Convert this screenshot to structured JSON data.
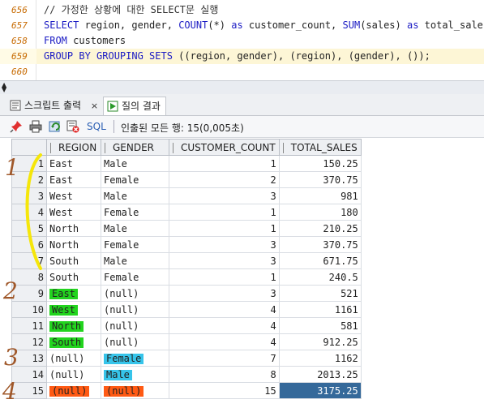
{
  "editor": {
    "lines": [
      {
        "num": "656",
        "tokens": [
          {
            "t": "// 가정한 상황에 대한 SELECT문 실행",
            "c": "cm"
          }
        ]
      },
      {
        "num": "657",
        "tokens": [
          {
            "t": "SELECT",
            "c": "kw"
          },
          {
            "t": " region, gender, ",
            "c": "pl"
          },
          {
            "t": "COUNT",
            "c": "fn"
          },
          {
            "t": "(*) ",
            "c": "pl"
          },
          {
            "t": "as",
            "c": "kw"
          },
          {
            "t": " customer_count, ",
            "c": "pl"
          },
          {
            "t": "SUM",
            "c": "fn"
          },
          {
            "t": "(sales) ",
            "c": "pl"
          },
          {
            "t": "as",
            "c": "kw"
          },
          {
            "t": " total_sales",
            "c": "pl"
          }
        ]
      },
      {
        "num": "658",
        "tokens": [
          {
            "t": "FROM",
            "c": "kw"
          },
          {
            "t": " customers",
            "c": "pl"
          }
        ]
      },
      {
        "num": "659",
        "tokens": [
          {
            "t": "GROUP BY GROUPING SETS",
            "c": "kw"
          },
          {
            "t": " ((region, gender), (region), (gender), ());",
            "c": "pl"
          }
        ]
      },
      {
        "num": "660",
        "tokens": []
      }
    ]
  },
  "tabs": {
    "script_output": "스크립트 출력",
    "close": "×",
    "query_result": "질의 결과"
  },
  "toolbar": {
    "sql": "SQL",
    "status": "인출된 모든 행: 15(0,005초)"
  },
  "grid": {
    "columns": [
      "REGION",
      "GENDER",
      "CUSTOMER_COUNT",
      "TOTAL_SALES"
    ],
    "rows": [
      {
        "n": "1",
        "region": "East",
        "gender": "Male",
        "count": "1",
        "sales": "150.25"
      },
      {
        "n": "2",
        "region": "East",
        "gender": "Female",
        "count": "2",
        "sales": "370.75"
      },
      {
        "n": "3",
        "region": "West",
        "gender": "Male",
        "count": "3",
        "sales": "981"
      },
      {
        "n": "4",
        "region": "West",
        "gender": "Female",
        "count": "1",
        "sales": "180"
      },
      {
        "n": "5",
        "region": "North",
        "gender": "Male",
        "count": "1",
        "sales": "210.25"
      },
      {
        "n": "6",
        "region": "North",
        "gender": "Female",
        "count": "3",
        "sales": "370.75"
      },
      {
        "n": "7",
        "region": "South",
        "gender": "Male",
        "count": "3",
        "sales": "671.75"
      },
      {
        "n": "8",
        "region": "South",
        "gender": "Female",
        "count": "1",
        "sales": "240.5"
      },
      {
        "n": "9",
        "region": "East",
        "gender": "(null)",
        "count": "3",
        "sales": "521",
        "hl_region": "green"
      },
      {
        "n": "10",
        "region": "West",
        "gender": "(null)",
        "count": "4",
        "sales": "1161",
        "hl_region": "green"
      },
      {
        "n": "11",
        "region": "North",
        "gender": "(null)",
        "count": "4",
        "sales": "581",
        "hl_region": "green"
      },
      {
        "n": "12",
        "region": "South",
        "gender": "(null)",
        "count": "4",
        "sales": "912.25",
        "hl_region": "green"
      },
      {
        "n": "13",
        "region": "(null)",
        "gender": "Female",
        "count": "7",
        "sales": "1162",
        "hl_gender": "blue"
      },
      {
        "n": "14",
        "region": "(null)",
        "gender": "Male",
        "count": "8",
        "sales": "2013.25",
        "hl_gender": "blue"
      },
      {
        "n": "15",
        "region": "(null)",
        "gender": "(null)",
        "count": "15",
        "sales": "3175.25",
        "hl_region": "orange",
        "hl_gender": "orange",
        "hl_total": true
      }
    ]
  },
  "annotations": [
    "1",
    "2",
    "3",
    "4"
  ],
  "colors": {
    "marker_green": "#22d41e",
    "marker_blue": "#36c4ea",
    "marker_orange": "#ff5a14",
    "marker_yellow": "#f5e60a",
    "annotation": "#a0582a",
    "selected_cell": "#35699a"
  }
}
